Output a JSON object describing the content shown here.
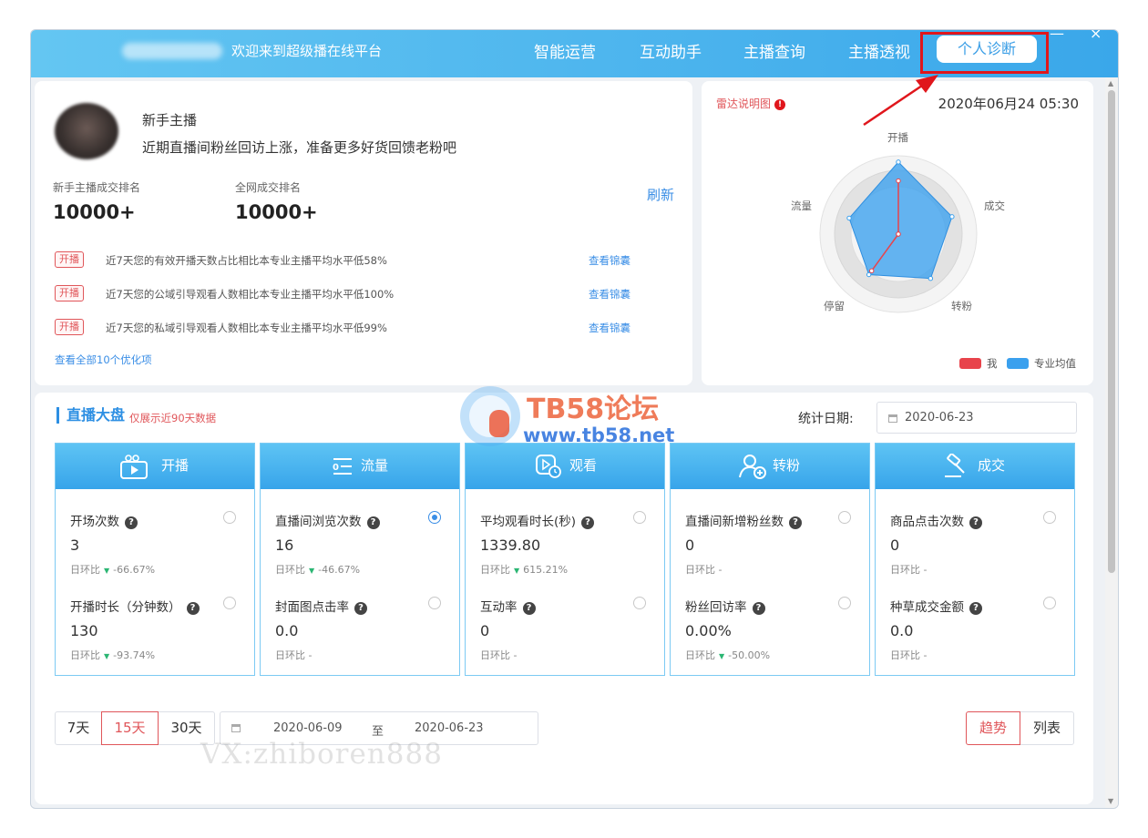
{
  "header": {
    "welcome": "欢迎来到超级播在线平台",
    "nav": [
      "智能运营",
      "互动助手",
      "主播查询",
      "主播透视"
    ],
    "active_nav": "个人诊断"
  },
  "profile": {
    "title": "新手主播",
    "message": "近期直播间粉丝回访上涨，准备更多好货回馈老粉吧",
    "rank1_label": "新手主播成交排名",
    "rank1_value": "10000+",
    "rank2_label": "全网成交排名",
    "rank2_value": "10000+",
    "refresh": "刷新",
    "tips": [
      {
        "tag": "开播",
        "text": "近7天您的有效开播天数占比相比本专业主播平均水平低58%",
        "link": "查看锦囊"
      },
      {
        "tag": "开播",
        "text": "近7天您的公域引导观看人数相比本专业主播平均水平低100%",
        "link": "查看锦囊"
      },
      {
        "tag": "开播",
        "text": "近7天您的私域引导观看人数相比本专业主播平均水平低99%",
        "link": "查看锦囊"
      }
    ],
    "view_all": "查看全部10个优化项"
  },
  "radar": {
    "title": "雷达说明图",
    "info": "!",
    "datetime": "2020年06月24 05:30",
    "axes": [
      "开播",
      "成交",
      "转粉",
      "停留",
      "流量"
    ],
    "legend_me": "我",
    "legend_avg": "专业均值",
    "colors": {
      "me": "#e8434b",
      "avg": "#3aa0ee"
    },
    "values_avg": [
      0.92,
      0.72,
      0.7,
      0.64,
      0.66
    ],
    "values_me": [
      0.68,
      0.0,
      0.0,
      0.58,
      0.0
    ]
  },
  "dashboard": {
    "title": "直播大盘",
    "note": "仅展示近90天数据",
    "date_label": "统计日期:",
    "date_value": "2020-06-23",
    "columns": [
      {
        "title": "开播",
        "icon": "video-play-icon",
        "metrics": [
          {
            "label": "开场次数",
            "value": "3",
            "sub": "日环比",
            "dir": "▼",
            "change": "-66.67%",
            "selected": false
          },
          {
            "label": "开播时长（分钟数）",
            "value": "130",
            "sub": "日环比",
            "dir": "▼",
            "change": "-93.74%",
            "selected": false
          }
        ]
      },
      {
        "title": "流量",
        "icon": "traffic-list-icon",
        "metrics": [
          {
            "label": "直播间浏览次数",
            "value": "16",
            "sub": "日环比",
            "dir": "▼",
            "change": "-46.67%",
            "selected": true
          },
          {
            "label": "封面图点击率",
            "value": "0.0",
            "sub": "日环比 -",
            "dir": "",
            "change": "",
            "selected": false
          }
        ]
      },
      {
        "title": "观看",
        "icon": "watch-clock-icon",
        "metrics": [
          {
            "label": "平均观看时长(秒)",
            "value": "1339.80",
            "sub": "日环比",
            "dir": "▼",
            "change": "615.21%",
            "selected": false
          },
          {
            "label": "互动率",
            "value": "0",
            "sub": "日环比 -",
            "dir": "",
            "change": "",
            "selected": false
          }
        ]
      },
      {
        "title": "转粉",
        "icon": "user-add-icon",
        "metrics": [
          {
            "label": "直播间新增粉丝数",
            "value": "0",
            "sub": "日环比 -",
            "dir": "",
            "change": "",
            "selected": false
          },
          {
            "label": "粉丝回访率",
            "value": "0.00%",
            "sub": "日环比",
            "dir": "▼",
            "change": "-50.00%",
            "selected": false
          }
        ]
      },
      {
        "title": "成交",
        "icon": "deal-hammer-icon",
        "metrics": [
          {
            "label": "商品点击次数",
            "value": "0",
            "sub": "日环比 -",
            "dir": "",
            "change": "",
            "selected": false
          },
          {
            "label": "种草成交金额",
            "value": "0.0",
            "sub": "日环比 -",
            "dir": "",
            "change": "",
            "selected": false
          }
        ]
      }
    ]
  },
  "range": {
    "options": [
      "7天",
      "15天",
      "30天"
    ],
    "active": "15天",
    "start": "2020-06-09",
    "to": "至",
    "end": "2020-06-23",
    "view_trend": "趋势",
    "view_list": "列表"
  },
  "watermark": {
    "title": "TB58论坛",
    "url": "www.tb58.net",
    "vx": "VX:zhiboren888"
  }
}
